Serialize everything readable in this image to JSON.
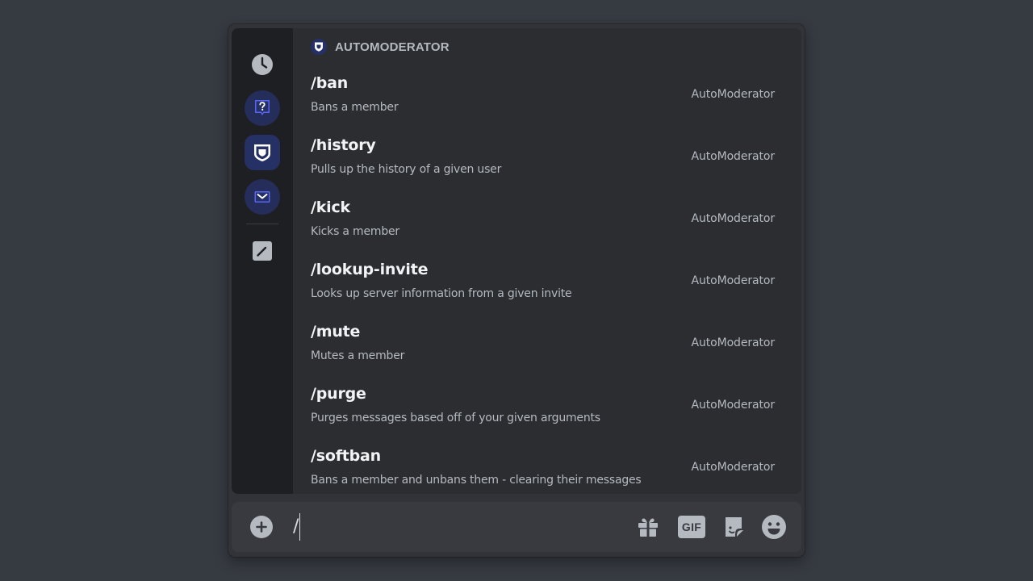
{
  "section": {
    "title": "AUTOMODERATOR"
  },
  "rail": {
    "items": [
      {
        "name": "recent-clock-icon"
      },
      {
        "name": "help-bot-icon"
      },
      {
        "name": "automoderator-shield-icon"
      },
      {
        "name": "mail-bot-icon"
      },
      {
        "name": "built-in-pencil-icon"
      }
    ]
  },
  "commands": [
    {
      "name": "/ban",
      "description": "Bans a member",
      "source": "AutoModerator"
    },
    {
      "name": "/history",
      "description": "Pulls up the history of a given user",
      "source": "AutoModerator"
    },
    {
      "name": "/kick",
      "description": "Kicks a member",
      "source": "AutoModerator"
    },
    {
      "name": "/lookup-invite",
      "description": "Looks up server information from a given invite",
      "source": "AutoModerator"
    },
    {
      "name": "/mute",
      "description": "Mutes a member",
      "source": "AutoModerator"
    },
    {
      "name": "/purge",
      "description": "Purges messages based off of your given arguments",
      "source": "AutoModerator"
    },
    {
      "name": "/softban",
      "description": "Bans a member and unbans them - clearing their messages",
      "source": "AutoModerator"
    }
  ],
  "composer": {
    "value": "/",
    "gif_label": "GIF",
    "icons": [
      "add-icon",
      "gift-icon",
      "gif-icon",
      "sticker-icon",
      "emoji-icon"
    ]
  },
  "colors": {
    "background": "#363a41",
    "panel": "#2b2d31",
    "rail": "#1e1f22",
    "accent_blue": "#5865f2",
    "text_primary": "#f2f3f5",
    "text_muted": "#b5bac1"
  }
}
